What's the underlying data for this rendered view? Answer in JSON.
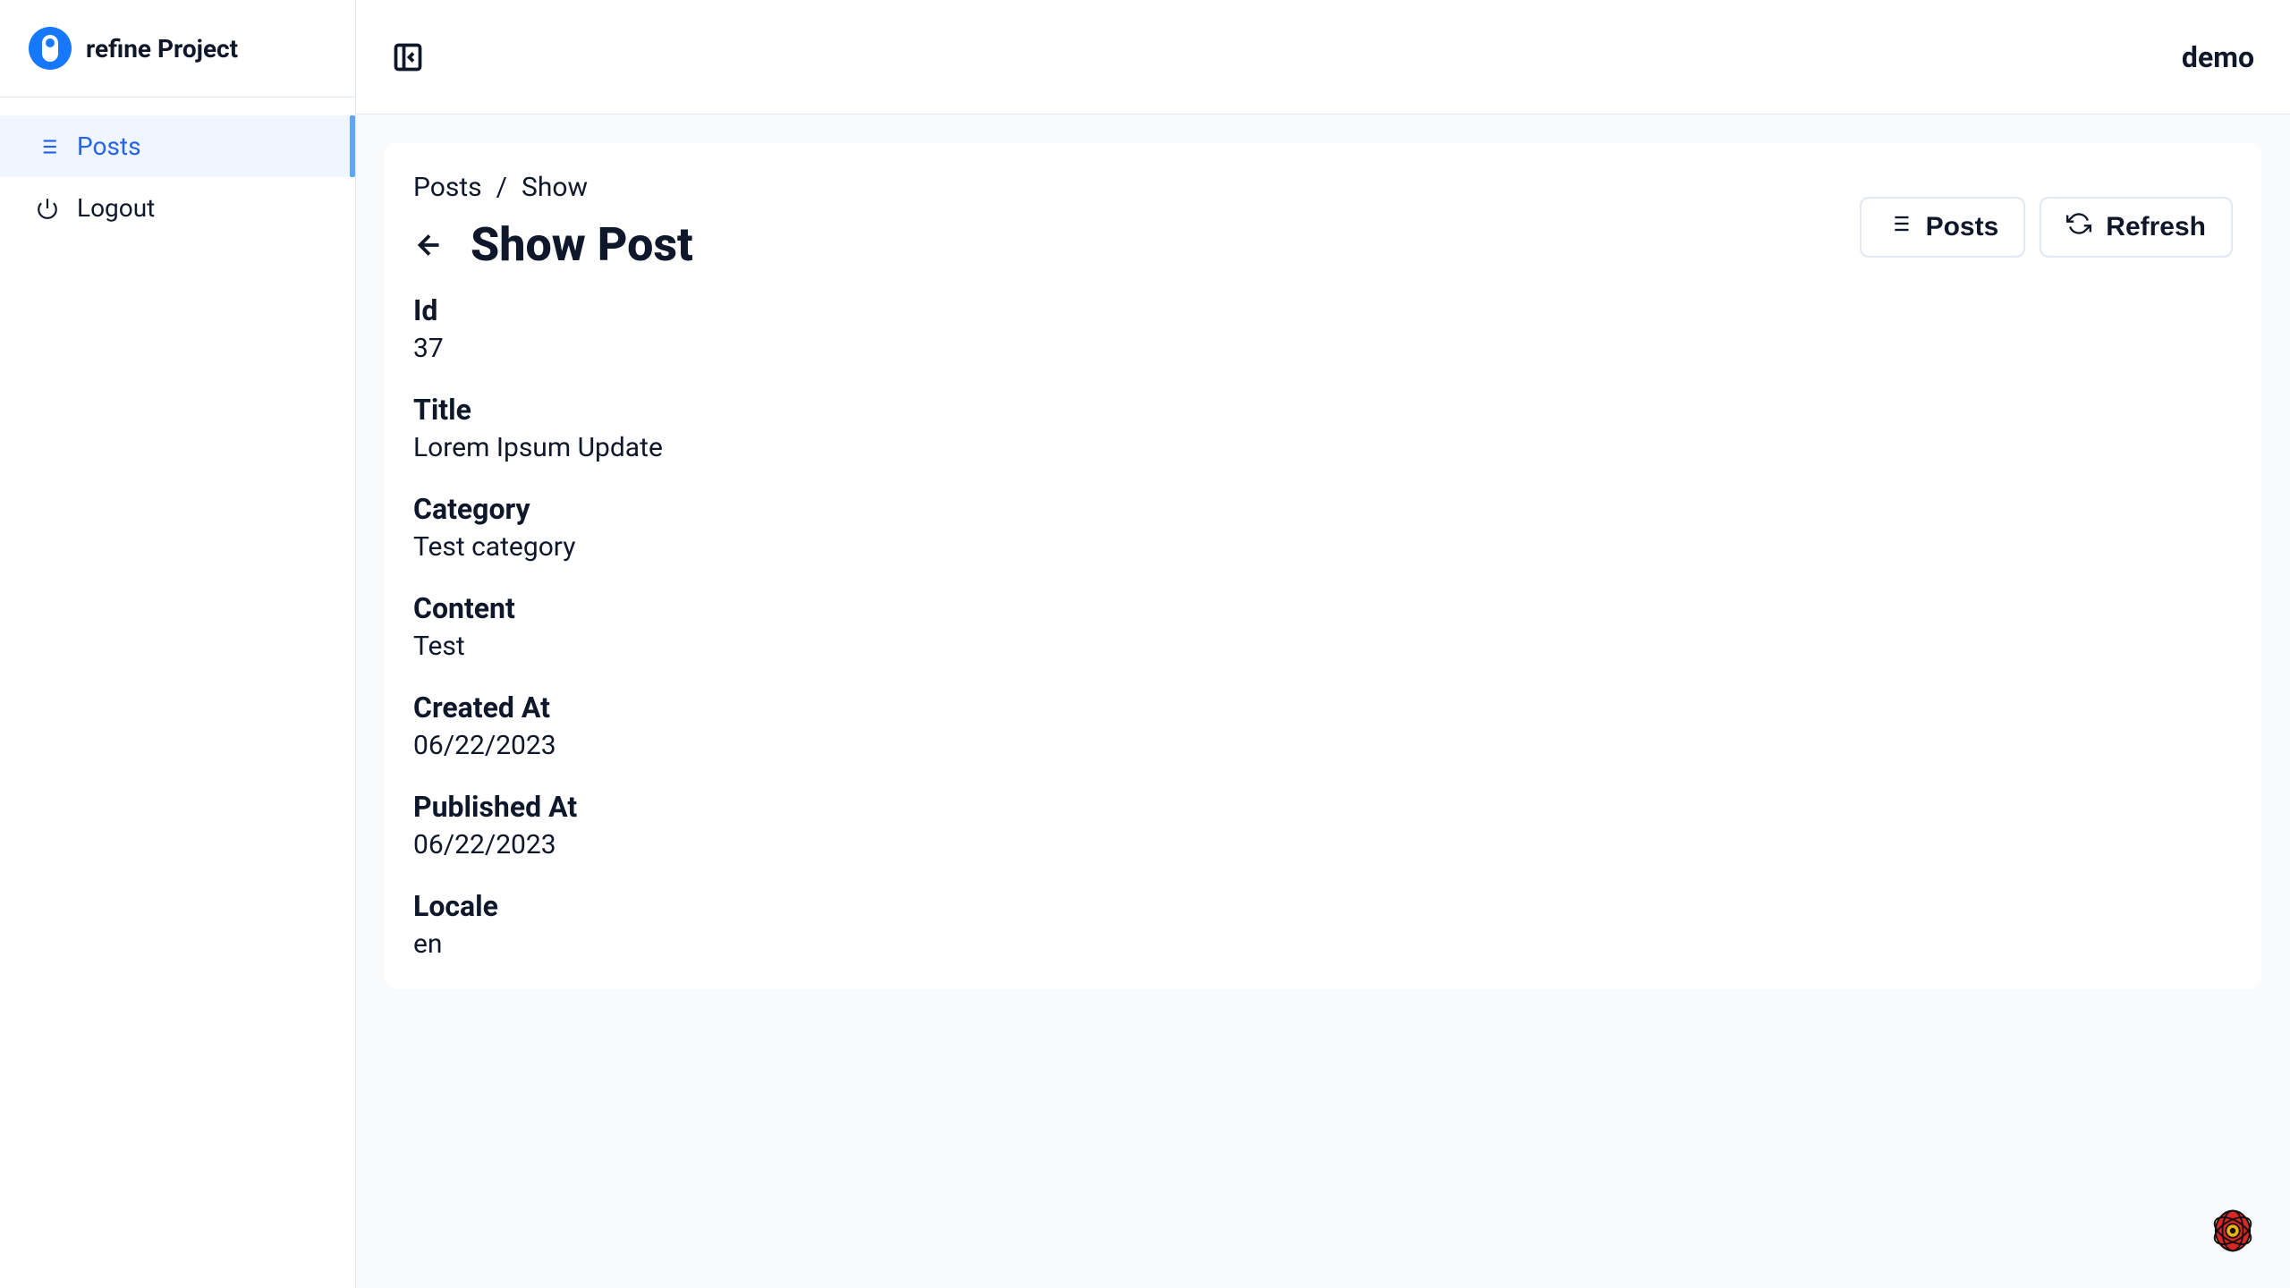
{
  "sidebar": {
    "title": "refine Project",
    "nav": [
      {
        "label": "Posts",
        "active": true,
        "icon": "list"
      },
      {
        "label": "Logout",
        "active": false,
        "icon": "power"
      }
    ]
  },
  "topbar": {
    "user": "demo"
  },
  "breadcrumbs": {
    "root": "Posts",
    "separator": "/",
    "current": "Show"
  },
  "page": {
    "title": "Show Post"
  },
  "actions": {
    "posts": "Posts",
    "refresh": "Refresh"
  },
  "fields": {
    "id_label": "Id",
    "id_value": "37",
    "title_label": "Title",
    "title_value": "Lorem Ipsum Update",
    "category_label": "Category",
    "category_value": "Test category",
    "content_label": "Content",
    "content_value": "Test",
    "created_at_label": "Created At",
    "created_at_value": "06/22/2023",
    "published_at_label": "Published At",
    "published_at_value": "06/22/2023",
    "locale_label": "Locale",
    "locale_value": "en"
  }
}
